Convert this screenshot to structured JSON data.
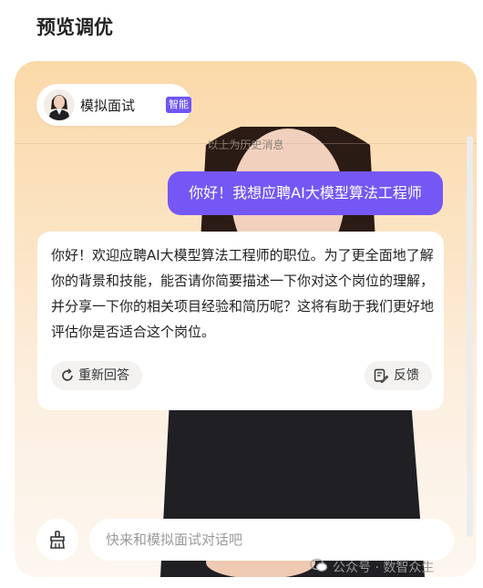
{
  "page": {
    "title": "预览调优"
  },
  "agent": {
    "name": "模拟面试",
    "badge": "智能体",
    "avatar_icon": "interviewer-avatar"
  },
  "history": {
    "label": "以上为历史消息"
  },
  "messages": {
    "user": "你好！我想应聘AI大模型算法工程师",
    "ai": "你好！欢迎应聘AI大模型算法工程师的职位。为了更全面地了解你的背景和技能，能否请你简要描述一下你对这个岗位的理解，并分享一下你的相关项目经验和简历呢？这将有助于我们更好地评估你是否适合这个岗位。"
  },
  "actions": {
    "regenerate": "重新回答",
    "feedback": "反馈"
  },
  "composer": {
    "placeholder": "快来和模拟面试对话吧",
    "clear_icon": "brush-icon"
  },
  "watermark": {
    "text": "公众号 · 数智众生"
  },
  "colors": {
    "accent": "#7557f5",
    "badge": "#6e56f7",
    "card_top": "#fbd9a9"
  }
}
